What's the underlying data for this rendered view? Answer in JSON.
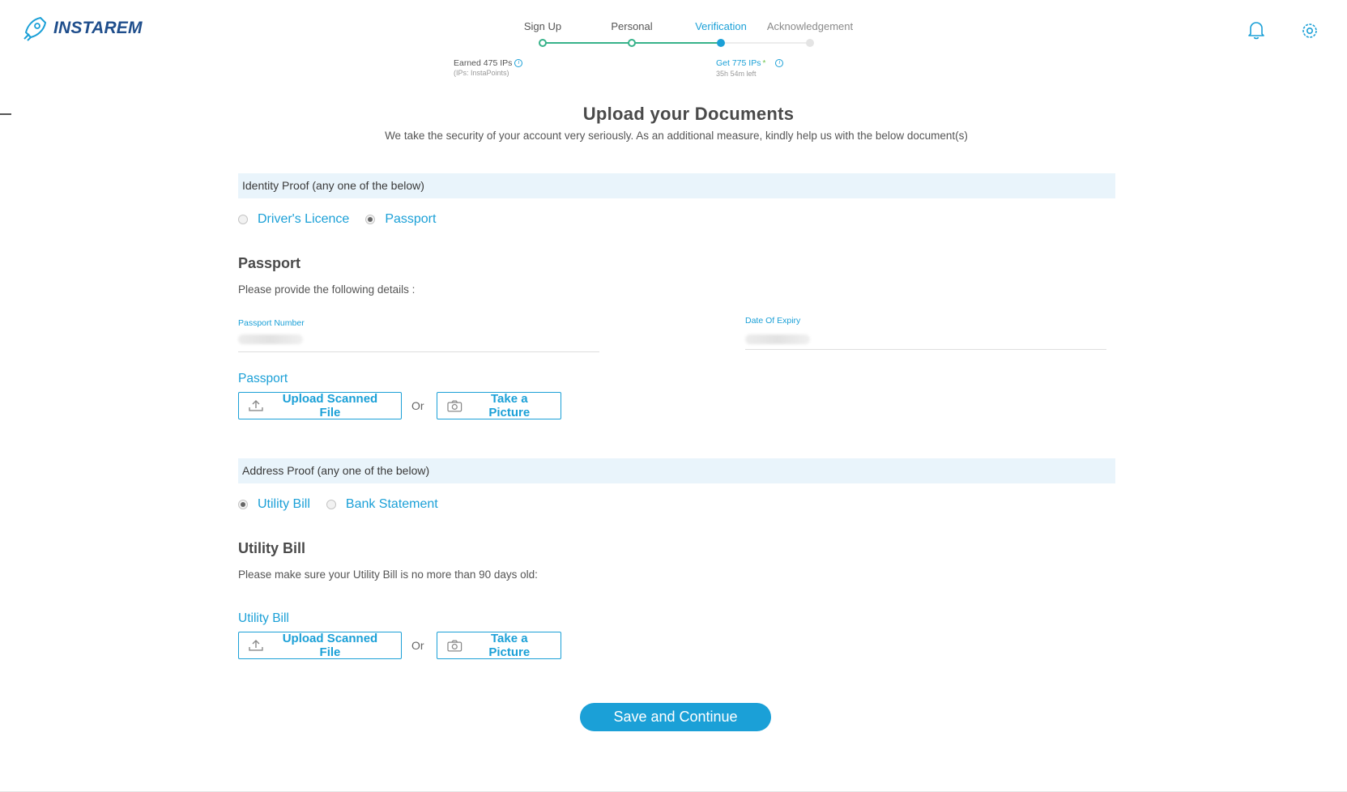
{
  "brand": {
    "name": "INSTAREM"
  },
  "stepper": {
    "steps": [
      {
        "label": "Sign Up",
        "state": "done"
      },
      {
        "label": "Personal",
        "state": "done"
      },
      {
        "label": "Verification",
        "state": "current"
      },
      {
        "label": "Acknowledgement",
        "state": "todo"
      }
    ],
    "earned": "Earned 475 IPs",
    "earned_sub": "(IPs: InstaPoints)",
    "get": "Get 775 IPs",
    "get_sub": "35h 54m left"
  },
  "header_icons": {
    "notifications": "bell-icon",
    "settings": "gear-icon"
  },
  "page": {
    "title": "Upload your Documents",
    "subtitle": "We take the security of your account very seriously. As an additional measure, kindly help us with the below document(s)"
  },
  "identity": {
    "section_title": "Identity Proof (any one of the below)",
    "options": [
      {
        "label": "Driver's Licence",
        "checked": false
      },
      {
        "label": "Passport",
        "checked": true
      }
    ],
    "heading": "Passport",
    "note": "Please provide the following details :",
    "fields": {
      "passport_number_label": "Passport Number",
      "expiry_label": "Date Of Expiry"
    },
    "upload_title": "Passport",
    "upload_label": "Upload Scanned File",
    "or_label": "Or",
    "picture_label": "Take a Picture"
  },
  "address": {
    "section_title": "Address Proof (any one of the below)",
    "options": [
      {
        "label": "Utility Bill",
        "checked": true
      },
      {
        "label": "Bank Statement",
        "checked": false
      }
    ],
    "heading": "Utility Bill",
    "note": "Please make sure your Utility Bill is no more than 90 days old:",
    "upload_title": "Utility Bill",
    "upload_label": "Upload Scanned File",
    "or_label": "Or",
    "picture_label": "Take a Picture"
  },
  "actions": {
    "save_label": "Save and Continue"
  },
  "colors": {
    "accent": "#1ba0d7",
    "success": "#37b28a",
    "section_bg": "#e9f4fb",
    "brand": "#1f4e8c"
  }
}
